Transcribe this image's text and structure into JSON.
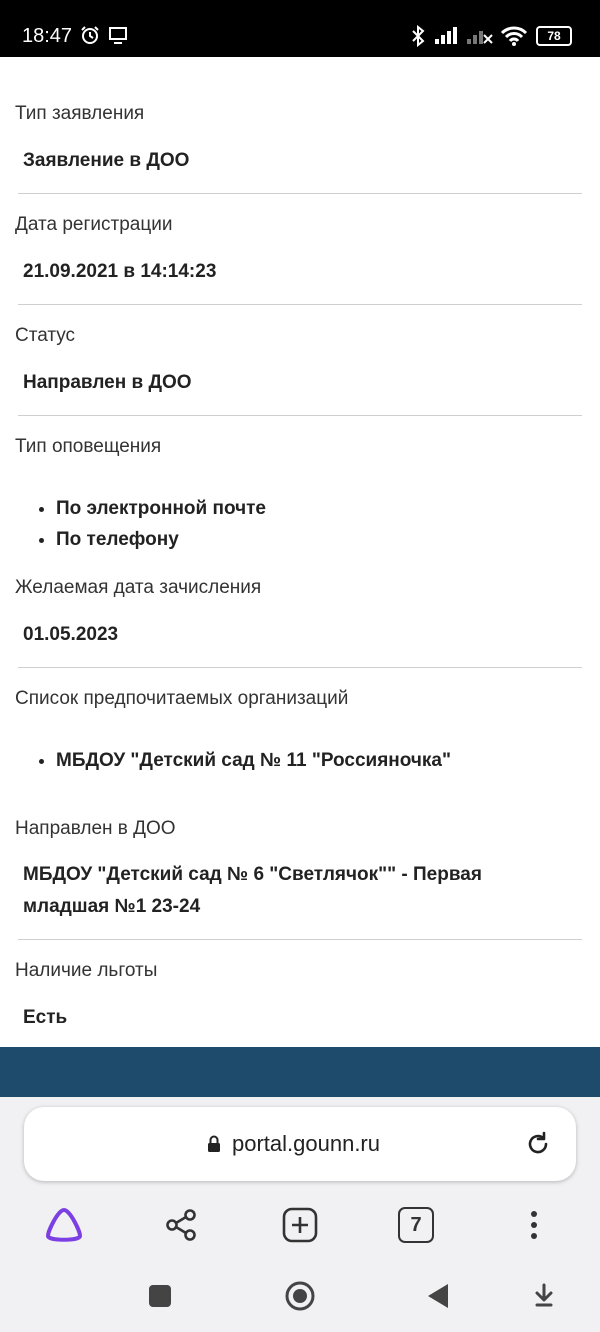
{
  "status_bar": {
    "time": "18:47",
    "battery": "78"
  },
  "fields": {
    "app_type": {
      "label": "Тип заявления",
      "value": "Заявление в ДОО"
    },
    "reg_date": {
      "label": "Дата регистрации",
      "value": "21.09.2021 в 14:14:23"
    },
    "status": {
      "label": "Статус",
      "value": "Направлен в ДОО"
    },
    "notify": {
      "label": "Тип оповещения",
      "items": [
        "По электронной почте",
        "По телефону"
      ]
    },
    "desired_date": {
      "label": "Желаемая дата зачисления",
      "value": "01.05.2023"
    },
    "orgs": {
      "label": "Список предпочитаемых организаций",
      "items": [
        "МБДОУ \"Детский сад № 11 \"Россияночка\""
      ]
    },
    "directed": {
      "label": "Направлен в ДОО",
      "value_line1": "МБДОУ \"Детский сад № 6 \"Светлячок\"\" - Первая",
      "value_line2": "младшая №1 23-24"
    },
    "benefit": {
      "label": "Наличие льготы",
      "value": "Есть"
    }
  },
  "browser": {
    "url": "portal.gounn.ru",
    "tabs_count": "7"
  },
  "colors": {
    "banner": "#1e4a6c",
    "alice": "#7b3fe4"
  }
}
